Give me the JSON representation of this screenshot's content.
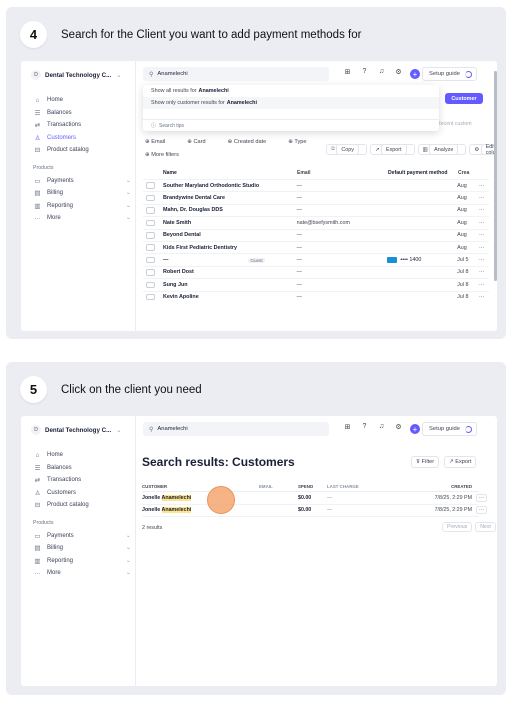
{
  "steps": [
    {
      "number": "4",
      "title": "Search for the Client you want to add payment methods for"
    },
    {
      "number": "5",
      "title": "Click on the client you need"
    }
  ],
  "account": {
    "initial": "D",
    "name": "Dental Technology C..."
  },
  "sidebar": {
    "items": [
      {
        "label": "Home",
        "icon": "home-icon",
        "glyph": "⌂"
      },
      {
        "label": "Balances",
        "icon": "balances-icon",
        "glyph": "☰"
      },
      {
        "label": "Transactions",
        "icon": "transactions-icon",
        "glyph": "⇄"
      },
      {
        "label": "Customers",
        "icon": "customers-icon",
        "glyph": "♙"
      },
      {
        "label": "Product catalog",
        "icon": "catalog-icon",
        "glyph": "⊟"
      }
    ],
    "section_label": "Products",
    "products": [
      {
        "label": "Payments",
        "icon": "payments-icon",
        "glyph": "▭"
      },
      {
        "label": "Billing",
        "icon": "billing-icon",
        "glyph": "▤"
      },
      {
        "label": "Reporting",
        "icon": "reporting-icon",
        "glyph": "▥"
      },
      {
        "label": "More",
        "icon": "more-icon",
        "glyph": "···"
      }
    ]
  },
  "topbar": {
    "search_value": "Anamelechi",
    "setup_label": "Setup guide"
  },
  "shot1": {
    "dropdown": {
      "row1_prefix": "Show all results for",
      "row1_term": "Anamelechi",
      "row2_prefix": "Show only customer results for",
      "row2_term": "Anamelechi",
      "tips": "Search tips"
    },
    "add_customer": "Customer",
    "recent": "Recent custom",
    "filters": [
      "Email",
      "Card",
      "Created date",
      "Type"
    ],
    "more_filters": "More filters",
    "actions": [
      "Copy",
      "Export",
      "Analyze",
      "Edit columns"
    ],
    "columns": [
      "Name",
      "Email",
      "Default payment method",
      "Crea"
    ],
    "rows": [
      {
        "name": "Souther Maryland Orthodontic Studio",
        "email": "—",
        "payment": "",
        "created": "Aug"
      },
      {
        "name": "Brandywine Dental Care",
        "email": "—",
        "payment": "",
        "created": "Aug"
      },
      {
        "name": "Mahn, Dr. Douglas DDS",
        "email": "—",
        "payment": "",
        "created": "Aug"
      },
      {
        "name": "Nate Smith",
        "email": "nate@bsefysmith.com",
        "payment": "",
        "created": "Aug"
      },
      {
        "name": "Beyond Dental",
        "email": "—",
        "payment": "",
        "created": "Aug"
      },
      {
        "name": "Kids First Pediatric Dentistry",
        "email": "—",
        "payment": "",
        "created": "Aug"
      },
      {
        "name": "—",
        "email": "—",
        "payment": "•••• 1400",
        "created": "Jul 5",
        "badge": "Guest"
      },
      {
        "name": "Robert Dost",
        "email": "—",
        "payment": "",
        "created": "Jul 8"
      },
      {
        "name": "Sung Jun",
        "email": "—",
        "payment": "",
        "created": "Jul 8"
      },
      {
        "name": "Kevin Apoline",
        "email": "—",
        "payment": "",
        "created": "Jul 8"
      }
    ]
  },
  "shot2": {
    "title": "Search results: Customers",
    "filter_label": "Filter",
    "export_label": "Export",
    "columns": [
      "CUSTOMER",
      "EMAIL",
      "SPEND",
      "LAST CHARGE",
      "CREATED"
    ],
    "rows": [
      {
        "first": "Jonelle",
        "last": "Anamelechi",
        "email": "",
        "spend": "$0.00",
        "last_charge": "—",
        "created": "7/8/25, 2:29 PM"
      },
      {
        "first": "Jonelle",
        "last": "Anamelechi",
        "email": "",
        "spend": "$0.00",
        "last_charge": "—",
        "created": "7/8/25, 2:29 PM"
      }
    ],
    "results": "2 results",
    "prev": "Previous",
    "next": "Next"
  }
}
